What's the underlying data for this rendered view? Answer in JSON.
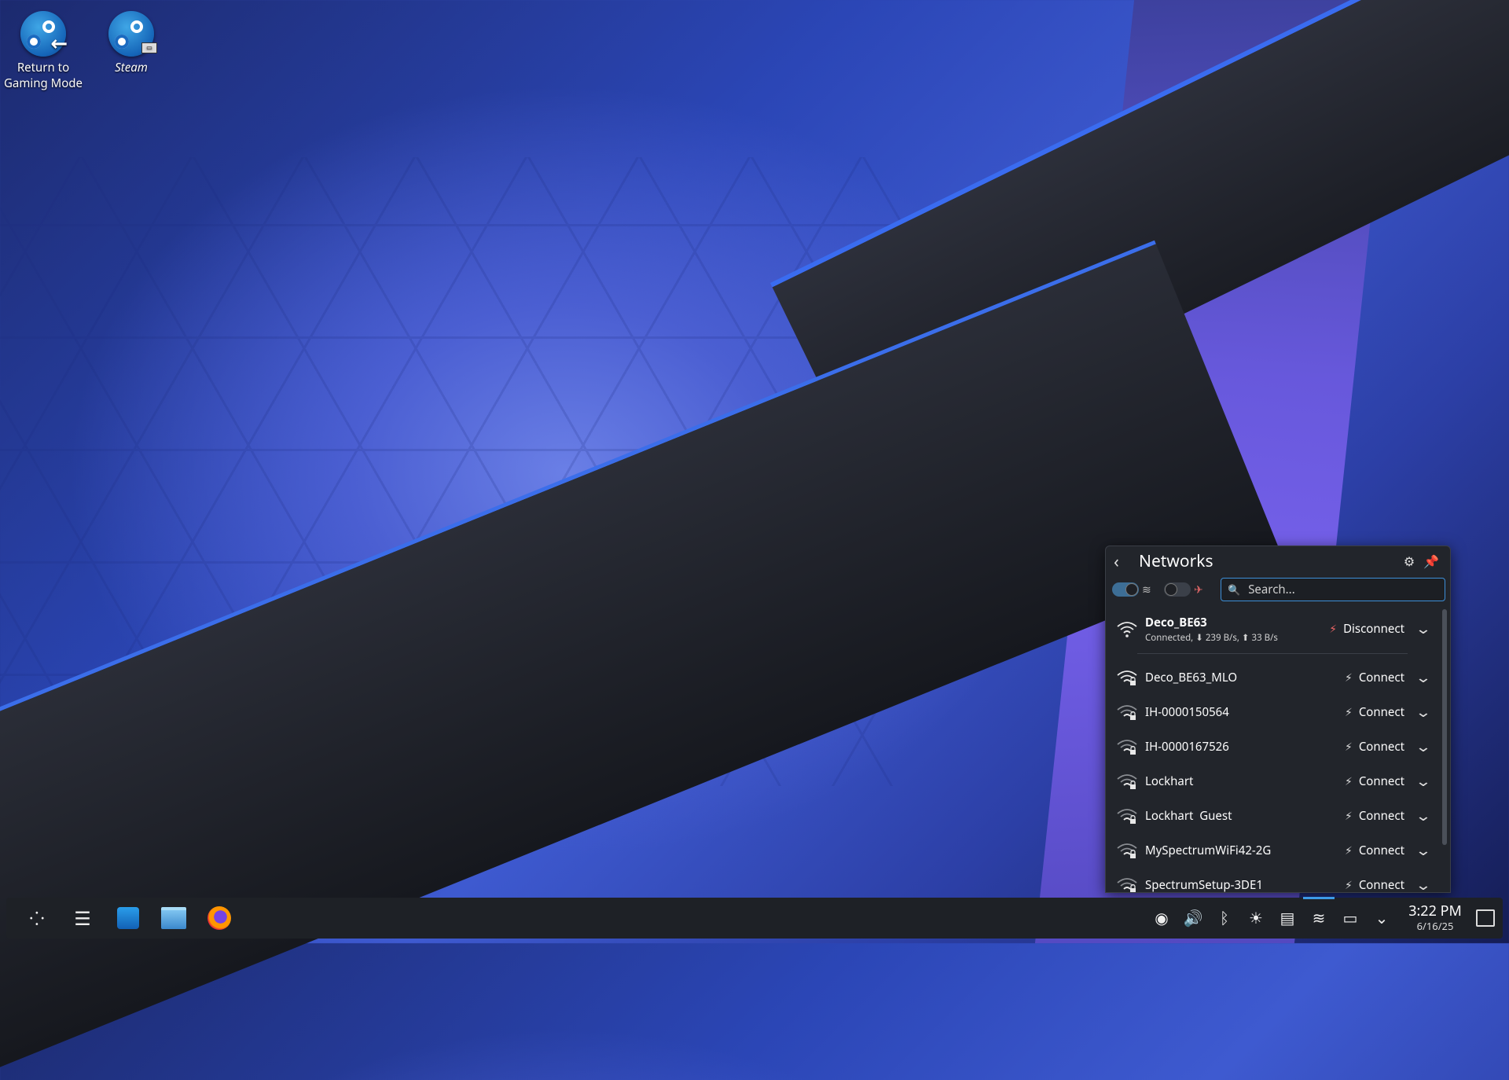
{
  "desktop": {
    "icons": [
      {
        "label_line1": "Return to",
        "label_line2": "Gaming Mode"
      },
      {
        "label": "Steam"
      }
    ]
  },
  "network_popup": {
    "title": "Networks",
    "search_placeholder": "Search...",
    "connected": {
      "ssid": "Deco_BE63",
      "status": "Connected, ⬇ 239 B/s, ⬆ 33 B/s",
      "action": "Disconnect"
    },
    "networks": [
      {
        "ssid": "Deco_BE63_MLO",
        "action": "Connect"
      },
      {
        "ssid": "IH-0000150564",
        "action": "Connect"
      },
      {
        "ssid": "IH-0000167526",
        "action": "Connect"
      },
      {
        "ssid": "Lockhart",
        "action": "Connect"
      },
      {
        "ssid": "Lockhart  Guest",
        "action": "Connect"
      },
      {
        "ssid": "MySpectrumWiFi42-2G",
        "action": "Connect"
      },
      {
        "ssid": "SpectrumSetup-3DE1",
        "action": "Connect"
      }
    ],
    "wifi_enabled": true,
    "airplane_mode": false
  },
  "taskbar": {
    "time": "3:22 PM",
    "date": "6/16/25",
    "accent_color": "#3d9ae8"
  }
}
